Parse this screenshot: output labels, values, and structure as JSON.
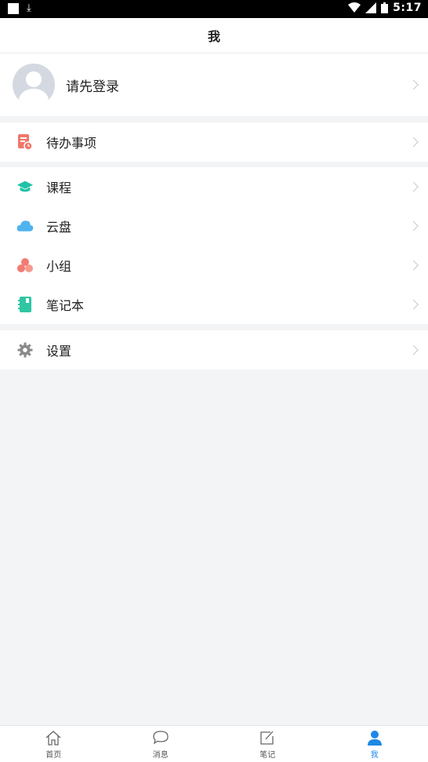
{
  "status_bar": {
    "time": "5:17"
  },
  "header": {
    "title": "我"
  },
  "profile": {
    "login_prompt": "请先登录"
  },
  "groups": [
    {
      "items": [
        {
          "label": "待办事项",
          "icon": "todo-icon",
          "color": "#f0766a"
        }
      ]
    },
    {
      "items": [
        {
          "label": "课程",
          "icon": "graduation-cap-icon",
          "color": "#1fc2a7"
        },
        {
          "label": "云盘",
          "icon": "cloud-icon",
          "color": "#4fb3ee"
        },
        {
          "label": "小组",
          "icon": "group-icon",
          "color": "#f27b72"
        },
        {
          "label": "笔记本",
          "icon": "notebook-icon",
          "color": "#2ec6a3"
        }
      ]
    },
    {
      "items": [
        {
          "label": "设置",
          "icon": "gear-icon",
          "color": "#8a8a8a"
        }
      ]
    }
  ],
  "tab_bar": {
    "tabs": [
      {
        "label": "首页",
        "icon": "home-icon"
      },
      {
        "label": "消息",
        "icon": "message-icon"
      },
      {
        "label": "笔记",
        "icon": "note-edit-icon"
      },
      {
        "label": "我",
        "icon": "person-icon",
        "active": true
      }
    ],
    "active_color": "#1e88e5"
  }
}
